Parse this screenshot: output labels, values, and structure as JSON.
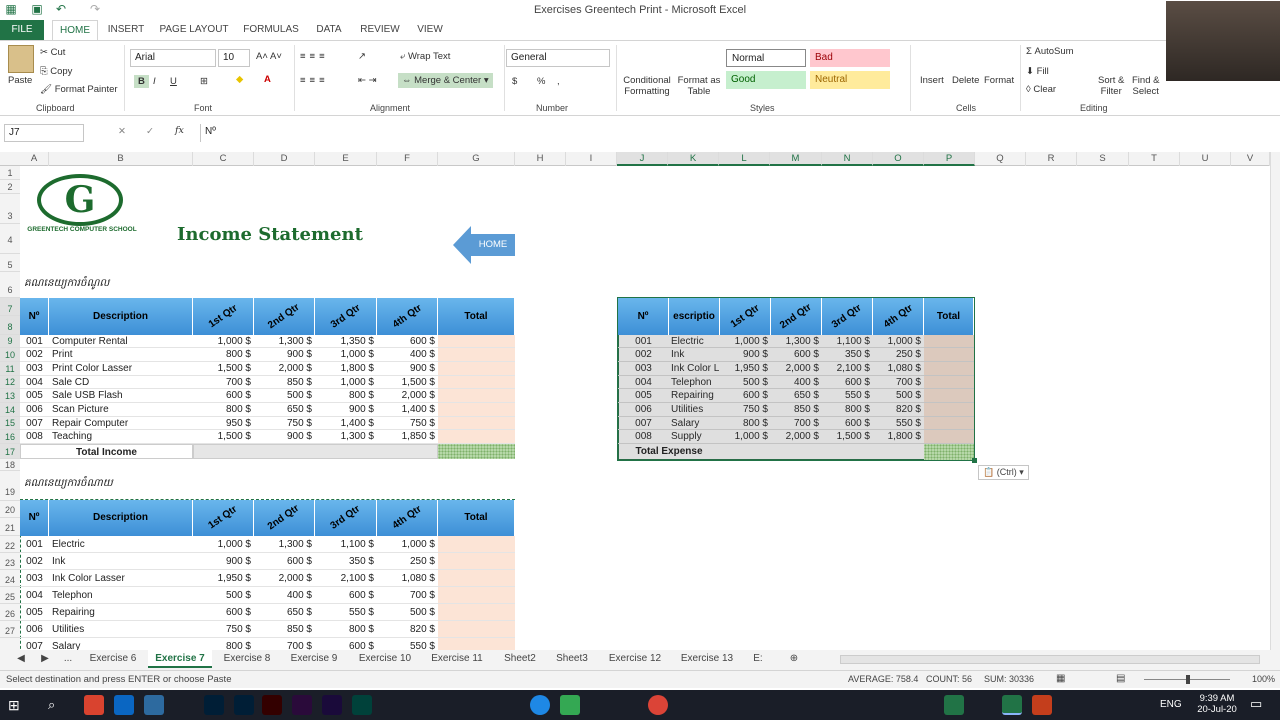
{
  "window": {
    "title": "Exercises Greentech Print - Microsoft Excel"
  },
  "ribbon_tabs": [
    "FILE",
    "HOME",
    "INSERT",
    "PAGE LAYOUT",
    "FORMULAS",
    "DATA",
    "REVIEW",
    "VIEW"
  ],
  "clipboard": {
    "cut": "Cut",
    "copy": "Copy",
    "paste": "Paste",
    "format_painter": "Format Painter",
    "group": "Clipboard"
  },
  "font": {
    "name": "Arial",
    "size": "10",
    "bold": "B",
    "italic": "I",
    "underline": "U",
    "group": "Font"
  },
  "alignment": {
    "wrap": "Wrap Text",
    "merge": "Merge & Center",
    "group": "Alignment"
  },
  "number": {
    "format": "General",
    "currency": "$",
    "percent": "%",
    "comma": ",",
    "group": "Number"
  },
  "styles": {
    "conditional": "Conditional",
    "conditional2": "Formatting",
    "format_as": "Format as",
    "table": "Table",
    "normal": "Normal",
    "bad": "Bad",
    "good": "Good",
    "neutral": "Neutral",
    "group": "Styles"
  },
  "cells": {
    "insert": "Insert",
    "delete": "Delete",
    "format": "Format",
    "group": "Cells"
  },
  "editing": {
    "autosum": "AutoSum",
    "fill": "Fill",
    "clear": "Clear",
    "sort": "Sort &",
    "filter": "Filter",
    "find": "Find &",
    "select": "Select",
    "group": "Editing"
  },
  "formula_bar": {
    "name_box": "J7",
    "fx": "fx",
    "content": "Nº"
  },
  "columns": [
    "A",
    "B",
    "C",
    "D",
    "E",
    "F",
    "G",
    "H",
    "I",
    "J",
    "K",
    "L",
    "M",
    "N",
    "O",
    "P",
    "Q",
    "R",
    "S",
    "T",
    "U",
    "V"
  ],
  "rows": [
    "1",
    "2",
    "3",
    "4",
    "5",
    "6",
    "7",
    "8",
    "9",
    "10",
    "11",
    "12",
    "13",
    "14",
    "15",
    "16",
    "17",
    "18",
    "19",
    "20",
    "21",
    "22",
    "23",
    "24",
    "25",
    "26",
    "27"
  ],
  "logo": {
    "letter": "G",
    "name": "GREENTECH COMPUTER SCHOOL"
  },
  "sheet_title": "Income Statement",
  "home_button": "HOME",
  "income_label": "គណនេយ្យការចំណូល",
  "expense_label": "គណនេយ្យការចំណាយ",
  "headers": {
    "no": "Nº",
    "desc": "Description",
    "q1": "1st Qtr",
    "q2": "2nd Qtr",
    "q3": "3rd Qtr",
    "q4": "4th Qtr",
    "total": "Total",
    "desc_short": "escriptio"
  },
  "income": [
    {
      "no": "001",
      "desc": "Computer Rental",
      "q": [
        "1,000 $",
        "1,300 $",
        "1,350 $",
        "600 $"
      ]
    },
    {
      "no": "002",
      "desc": "Print",
      "q": [
        "800 $",
        "900 $",
        "1,000 $",
        "400 $"
      ]
    },
    {
      "no": "003",
      "desc": "Print Color Lasser",
      "q": [
        "1,500 $",
        "2,000 $",
        "1,800 $",
        "900 $"
      ]
    },
    {
      "no": "004",
      "desc": "Sale CD",
      "q": [
        "700 $",
        "850 $",
        "1,000 $",
        "1,500 $"
      ]
    },
    {
      "no": "005",
      "desc": "Sale USB Flash",
      "q": [
        "600 $",
        "500 $",
        "800 $",
        "2,000 $"
      ]
    },
    {
      "no": "006",
      "desc": "Scan Picture",
      "q": [
        "800 $",
        "650 $",
        "900 $",
        "1,400 $"
      ]
    },
    {
      "no": "007",
      "desc": "Repair Computer",
      "q": [
        "950 $",
        "750 $",
        "1,400 $",
        "750 $"
      ]
    },
    {
      "no": "008",
      "desc": "Teaching",
      "q": [
        "1,500 $",
        "900 $",
        "1,300 $",
        "1,850 $"
      ]
    }
  ],
  "total_income": "Total Income",
  "expense": [
    {
      "no": "001",
      "desc": "Electric",
      "q": [
        "1,000 $",
        "1,300 $",
        "1,100 $",
        "1,000 $"
      ]
    },
    {
      "no": "002",
      "desc": "Ink",
      "q": [
        "900 $",
        "600 $",
        "350 $",
        "250 $"
      ]
    },
    {
      "no": "003",
      "desc": "Ink Color Lasser",
      "short": "Ink Color L",
      "q": [
        "1,950 $",
        "2,000 $",
        "2,100 $",
        "1,080 $"
      ]
    },
    {
      "no": "004",
      "desc": "Telephon",
      "q": [
        "500 $",
        "400 $",
        "600 $",
        "700 $"
      ]
    },
    {
      "no": "005",
      "desc": "Repairing",
      "q": [
        "600 $",
        "650 $",
        "550 $",
        "500 $"
      ]
    },
    {
      "no": "006",
      "desc": "Utilities",
      "q": [
        "750 $",
        "850 $",
        "800 $",
        "820 $"
      ]
    },
    {
      "no": "007",
      "desc": "Salary",
      "q": [
        "800 $",
        "700 $",
        "600 $",
        "550 $"
      ]
    },
    {
      "no": "008",
      "desc": "Supply",
      "q": [
        "1,000 $",
        "2,000 $",
        "1,500 $",
        "1,800 $"
      ]
    }
  ],
  "total_expense": "Total Expense",
  "paste_options": "(Ctrl)",
  "sheet_tabs": [
    "...",
    "Exercise 6",
    "Exercise 7",
    "Exercise 8",
    "Exercise 9",
    "Exercise 10",
    "Exercise 11",
    "Sheet2",
    "Sheet3",
    "Exercise 12",
    "Exercise 13",
    "E:"
  ],
  "status": {
    "message": "Select destination and press ENTER or choose Paste",
    "average": "AVERAGE: 758.4",
    "count": "COUNT: 56",
    "sum": "SUM: 30336",
    "zoom": "100%"
  },
  "taskbar": {
    "lang": "ENG",
    "time": "9:39 AM",
    "date": "20-Jul-20"
  }
}
